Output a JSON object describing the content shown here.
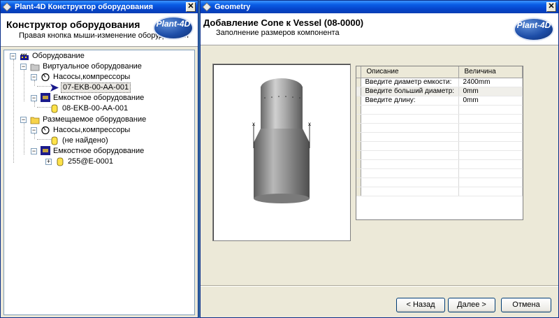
{
  "left_window": {
    "title": "Plant-4D Конструктор оборудования",
    "header_title": "Конструктор оборудования",
    "header_subtitle": "Правая кнопка мыши-изменение оборудования",
    "logo_text": "Plant-4D",
    "tree": {
      "root": "Оборудование",
      "virtual": "Виртуальное оборудование",
      "virtual_pumps": "Насосы,компрессоры",
      "virtual_pump_item": "07-EKB-00-AA-001",
      "virtual_vessels": "Емкостное оборудование",
      "virtual_vessel_item": "08-EKB-00-AA-001",
      "placed": "Размещаемое оборудование",
      "placed_pumps": "Насосы,компрессоры",
      "placed_pump_item": "(не найдено)",
      "placed_vessels": "Емкостное оборудование",
      "placed_vessel_item": "255@E-0001"
    },
    "icons": {
      "root": "factory-icon",
      "folder_virtual": "folder-gray-icon",
      "folder_placed": "folder-yellow-icon",
      "pump": "pump-icon",
      "vessel_group": "vessel-group-icon",
      "vessel": "vessel-icon",
      "selected_arrow": "arrow-pointer-icon"
    }
  },
  "right_window": {
    "title": "Geometry",
    "header_title": "Добавление Cone к Vessel (08-0000)",
    "header_subtitle": "Заполнение размеров компонента",
    "logo_text": "Plant-4D",
    "grid": {
      "col_description": "Описание",
      "col_value": "Величина",
      "rows": [
        {
          "label": "Введите диаметр емкости:",
          "value": "2400mm"
        },
        {
          "label": "Введите больший диаметр:",
          "value": "0mm"
        },
        {
          "label": "Введите длину:",
          "value": "0mm"
        }
      ]
    },
    "buttons": {
      "back": "< Назад",
      "next": "Далее >",
      "cancel": "Отмена"
    }
  },
  "colors": {
    "titlebar": "#0a5ee6",
    "window_bg": "#ece9d8",
    "logo": "#1e4ea8"
  }
}
